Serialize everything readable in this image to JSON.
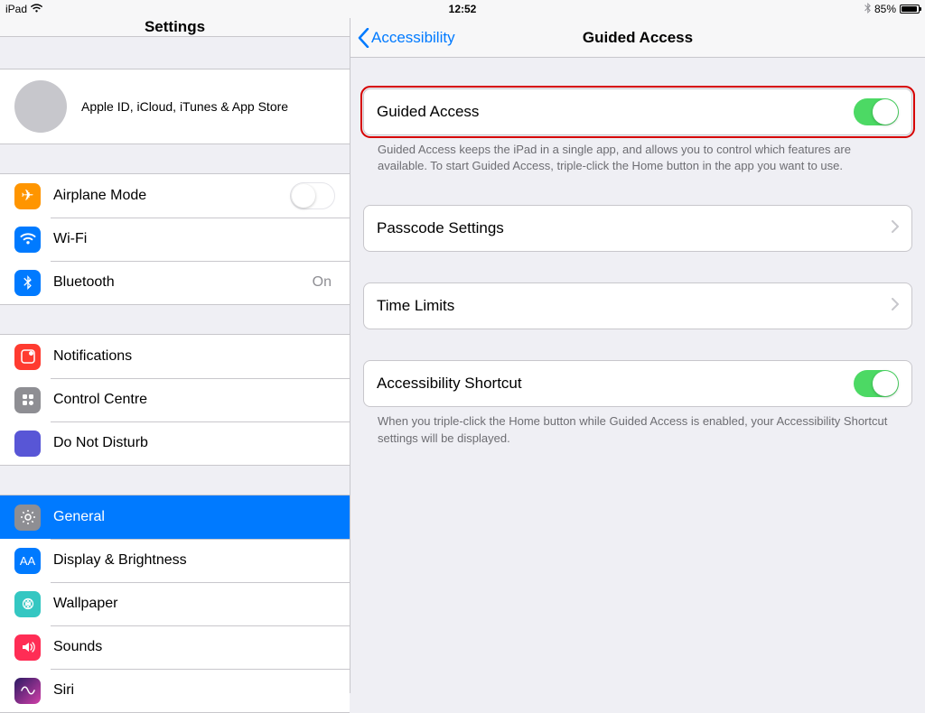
{
  "statusbar": {
    "device": "iPad",
    "time": "12:52",
    "battery_pct": "85%"
  },
  "sidebar": {
    "title": "Settings",
    "profile": "Apple ID, iCloud, iTunes & App Store",
    "group1": {
      "airplane": "Airplane Mode",
      "wifi": "Wi-Fi",
      "bluetooth": "Bluetooth",
      "bluetooth_value": "On"
    },
    "group2": {
      "notifications": "Notifications",
      "control_centre": "Control Centre",
      "dnd": "Do Not Disturb"
    },
    "group3": {
      "general": "General",
      "display": "Display & Brightness",
      "wallpaper": "Wallpaper",
      "sounds": "Sounds",
      "siri": "Siri"
    }
  },
  "detail": {
    "back": "Accessibility",
    "title": "Guided Access",
    "rows": {
      "guided_access": "Guided Access",
      "passcode_settings": "Passcode Settings",
      "time_limits": "Time Limits",
      "accessibility_shortcut": "Accessibility Shortcut"
    },
    "footer1": "Guided Access keeps the iPad in a single app, and allows you to control which features are available. To start Guided Access, triple-click the Home button in the app you want to use.",
    "footer2": "When you triple-click the Home button while Guided Access is enabled, your Accessibility Shortcut settings will be displayed."
  }
}
